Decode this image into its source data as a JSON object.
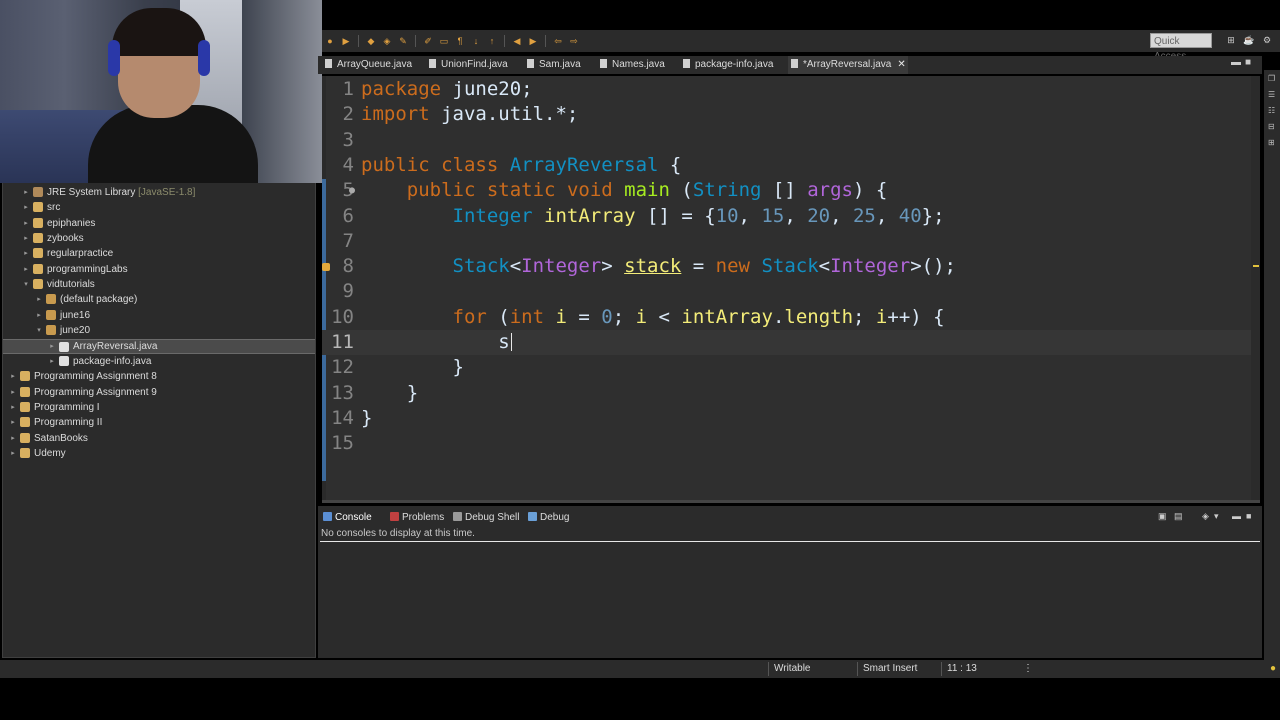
{
  "quick_access": {
    "label": "Quick Access"
  },
  "tree": {
    "items": [
      {
        "label": "JRE System Library",
        "suffix": "[JavaSE-1.8]",
        "depth": 1,
        "arrow": "▸",
        "icon": "library-icon"
      },
      {
        "label": "src",
        "depth": 1,
        "arrow": "▸",
        "icon": "folder-icon"
      },
      {
        "label": "epiphanies",
        "depth": 1,
        "arrow": "▸",
        "icon": "folder-icon"
      },
      {
        "label": "zybooks",
        "depth": 1,
        "arrow": "▸",
        "icon": "folder-icon"
      },
      {
        "label": "regularpractice",
        "depth": 1,
        "arrow": "▸",
        "icon": "folder-icon"
      },
      {
        "label": "programmingLabs",
        "depth": 1,
        "arrow": "▸",
        "icon": "folder-icon"
      },
      {
        "label": "vidtutorials",
        "depth": 1,
        "arrow": "▾",
        "icon": "folder-icon"
      },
      {
        "label": "(default package)",
        "depth": 2,
        "arrow": "▸",
        "icon": "package-icon"
      },
      {
        "label": "june16",
        "depth": 2,
        "arrow": "▸",
        "icon": "package-icon"
      },
      {
        "label": "june20",
        "depth": 2,
        "arrow": "▾",
        "icon": "package-icon"
      },
      {
        "label": "ArrayReversal.java",
        "depth": 3,
        "arrow": "▸",
        "icon": "java-file-icon",
        "selected": true
      },
      {
        "label": "package-info.java",
        "depth": 3,
        "arrow": "▸",
        "icon": "java-file-icon"
      },
      {
        "label": "Programming Assignment 8",
        "depth": 0,
        "arrow": "▸",
        "icon": "project-icon"
      },
      {
        "label": "Programming Assignment 9",
        "depth": 0,
        "arrow": "▸",
        "icon": "project-icon"
      },
      {
        "label": "Programming I",
        "depth": 0,
        "arrow": "▸",
        "icon": "project-icon"
      },
      {
        "label": "Programming II",
        "depth": 0,
        "arrow": "▸",
        "icon": "project-icon"
      },
      {
        "label": "SatanBooks",
        "depth": 0,
        "arrow": "▸",
        "icon": "project-icon"
      },
      {
        "label": "Udemy",
        "depth": 0,
        "arrow": "▸",
        "icon": "project-icon"
      }
    ]
  },
  "editor_tabs": [
    {
      "label": "ArrayQueue.java"
    },
    {
      "label": "UnionFind.java"
    },
    {
      "label": "Sam.java"
    },
    {
      "label": "Names.java"
    },
    {
      "label": "package-info.java"
    },
    {
      "label": "*ArrayReversal.java",
      "active": true,
      "close": "✕"
    }
  ],
  "code": {
    "line_numbers": [
      "1",
      "2",
      "3",
      "4",
      "5",
      "6",
      "7",
      "8",
      "9",
      "10",
      "11",
      "12",
      "13",
      "14",
      "15"
    ],
    "current_line": 11,
    "lines": [
      [
        [
          "kw",
          "package"
        ],
        [
          "plain",
          " june20;"
        ]
      ],
      [
        [
          "kw",
          "import"
        ],
        [
          "plain",
          " java.util.*;"
        ]
      ],
      [],
      [
        [
          "kw",
          "public"
        ],
        [
          "plain",
          " "
        ],
        [
          "kw",
          "class"
        ],
        [
          "plain",
          " "
        ],
        [
          "ty",
          "ArrayReversal"
        ],
        [
          "plain",
          " {"
        ]
      ],
      [
        [
          "plain",
          "    "
        ],
        [
          "kw",
          "public"
        ],
        [
          "plain",
          " "
        ],
        [
          "kw",
          "static"
        ],
        [
          "plain",
          " "
        ],
        [
          "kw",
          "void"
        ],
        [
          "plain",
          " "
        ],
        [
          "fn",
          "main"
        ],
        [
          "plain",
          " ("
        ],
        [
          "ty",
          "String"
        ],
        [
          "plain",
          " [] "
        ],
        [
          "gen",
          "args"
        ],
        [
          "plain",
          ") {"
        ]
      ],
      [
        [
          "plain",
          "        "
        ],
        [
          "ty",
          "Integer"
        ],
        [
          "plain",
          " "
        ],
        [
          "var",
          "intArray"
        ],
        [
          "plain",
          " [] = {"
        ],
        [
          "num",
          "10"
        ],
        [
          "plain",
          ", "
        ],
        [
          "num",
          "15"
        ],
        [
          "plain",
          ", "
        ],
        [
          "num",
          "20"
        ],
        [
          "plain",
          ", "
        ],
        [
          "num",
          "25"
        ],
        [
          "plain",
          ", "
        ],
        [
          "num",
          "40"
        ],
        [
          "plain",
          "};"
        ]
      ],
      [],
      [
        [
          "plain",
          "        "
        ],
        [
          "ty",
          "Stack"
        ],
        [
          "plain",
          "<"
        ],
        [
          "gen",
          "Integer"
        ],
        [
          "plain",
          "> "
        ],
        [
          "var-ul",
          "stack"
        ],
        [
          "plain",
          " = "
        ],
        [
          "kw",
          "new"
        ],
        [
          "plain",
          " "
        ],
        [
          "ty",
          "Stack"
        ],
        [
          "plain",
          "<"
        ],
        [
          "gen",
          "Integer"
        ],
        [
          "plain",
          ">();"
        ]
      ],
      [],
      [
        [
          "plain",
          "        "
        ],
        [
          "kw",
          "for"
        ],
        [
          "plain",
          " ("
        ],
        [
          "kw",
          "int"
        ],
        [
          "plain",
          " "
        ],
        [
          "var",
          "i"
        ],
        [
          "plain",
          " = "
        ],
        [
          "num",
          "0"
        ],
        [
          "plain",
          "; "
        ],
        [
          "var",
          "i"
        ],
        [
          "plain",
          " < "
        ],
        [
          "var",
          "intArray"
        ],
        [
          "plain",
          "."
        ],
        [
          "var",
          "length"
        ],
        [
          "plain",
          "; "
        ],
        [
          "var",
          "i"
        ],
        [
          "plain",
          "++) {"
        ]
      ],
      [
        [
          "plain",
          "            "
        ],
        [
          "plain-cursor",
          "s"
        ]
      ],
      [
        [
          "plain",
          "        }"
        ]
      ],
      [
        [
          "plain",
          "    }"
        ]
      ],
      [
        [
          "plain",
          "}"
        ]
      ],
      []
    ]
  },
  "console": {
    "tabs": [
      {
        "label": "Console",
        "active": true,
        "color": "#5b8fd4"
      },
      {
        "label": "Problems",
        "color": "#c04040"
      },
      {
        "label": "Debug Shell",
        "color": "#9a9a9a"
      },
      {
        "label": "Debug",
        "color": "#6aa0d8"
      }
    ],
    "message": "No consoles to display at this time."
  },
  "status": {
    "mode": "Writable",
    "insert": "Smart Insert",
    "position": "11 : 13"
  }
}
